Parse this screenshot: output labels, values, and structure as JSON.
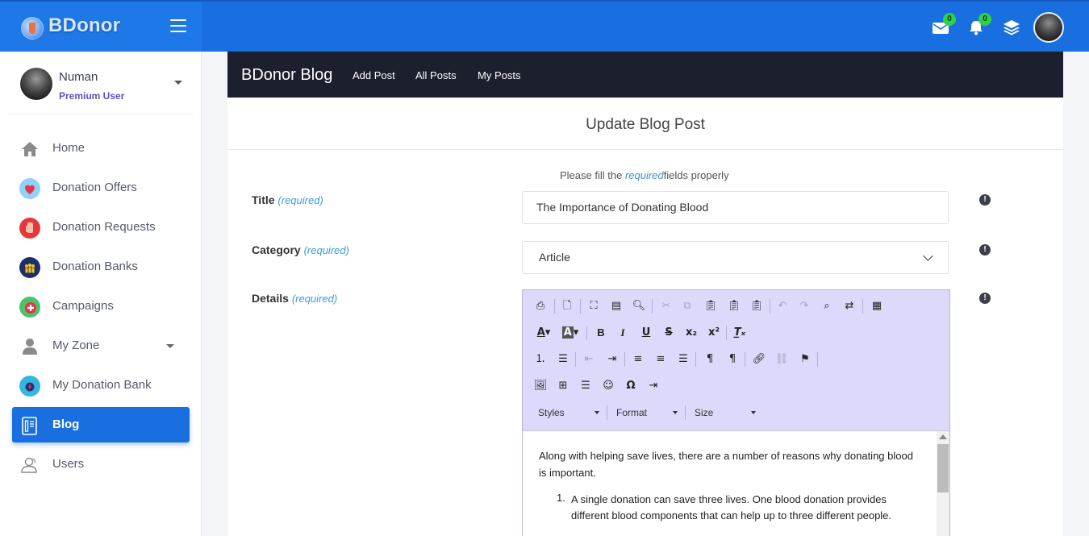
{
  "app": {
    "brand": "BDonor"
  },
  "topbar": {
    "mail_badge": "0",
    "bell_badge": "0",
    "icons": [
      "envelope-icon",
      "bell-icon",
      "layers-icon"
    ]
  },
  "profile": {
    "name": "Numan",
    "role": "Premium User"
  },
  "sidebar": {
    "items": [
      {
        "label": "Home",
        "icon": "home-icon"
      },
      {
        "label": "Donation Offers",
        "icon": "heart-offer-icon"
      },
      {
        "label": "Donation Requests",
        "icon": "hand-request-icon"
      },
      {
        "label": "Donation Banks",
        "icon": "bank-icon"
      },
      {
        "label": "Campaigns",
        "icon": "campaign-icon"
      },
      {
        "label": "My Zone",
        "icon": "user-icon"
      },
      {
        "label": "My Donation Bank",
        "icon": "my-bank-icon"
      },
      {
        "label": "Blog",
        "icon": "blog-icon"
      },
      {
        "label": "Users",
        "icon": "users-icon"
      }
    ],
    "active": "Blog"
  },
  "blognav": {
    "brand": "BDonor Blog",
    "links": [
      "Add Post",
      "All Posts",
      "My Posts"
    ]
  },
  "form": {
    "heading": "Update Blog Post",
    "hint_before": "Please fill the ",
    "hint_required": "required",
    "hint_after": "fields properly",
    "required_tag": "(required)",
    "title_label": "Title",
    "title_value": "The Importance of Donating Blood",
    "category_label": "Category",
    "category_value": "Article",
    "details_label": "Details"
  },
  "editor": {
    "combos": [
      "Styles",
      "Format",
      "Size"
    ],
    "paragraph": "Along with helping save lives, there are a number of reasons why donating blood is important.",
    "list_number": "1.",
    "list_item": "A single donation can save three lives. One blood donation provides different blood components that can help up to three different people."
  },
  "colors": {
    "primary": "#1a6fe0",
    "blognav": "#1c1f2e",
    "toolbar": "#dcd9fb",
    "badge": "#2fd14a",
    "required": "#3e9ad8"
  }
}
